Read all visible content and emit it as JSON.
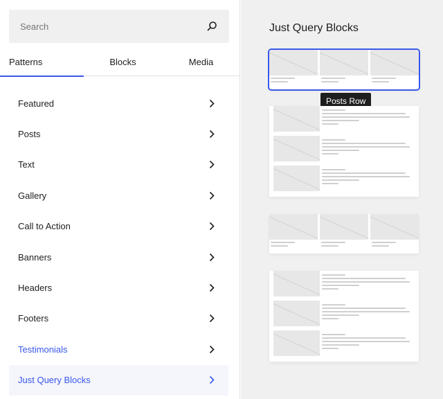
{
  "search": {
    "placeholder": "Search"
  },
  "tabs": [
    {
      "label": "Patterns",
      "active": true
    },
    {
      "label": "Blocks",
      "active": false
    },
    {
      "label": "Media",
      "active": false
    }
  ],
  "categories": [
    {
      "label": "Featured"
    },
    {
      "label": "Posts"
    },
    {
      "label": "Text"
    },
    {
      "label": "Gallery"
    },
    {
      "label": "Call to Action"
    },
    {
      "label": "Banners"
    },
    {
      "label": "Headers"
    },
    {
      "label": "Footers"
    },
    {
      "label": "Testimonials"
    },
    {
      "label": "Just Query Blocks"
    }
  ],
  "preview": {
    "title": "Just Query Blocks",
    "tooltip": "Posts Row"
  },
  "colors": {
    "accent": "#3858e9",
    "panel_bg": "#f0f0f0",
    "tooltip_bg": "#1e1e1e"
  }
}
